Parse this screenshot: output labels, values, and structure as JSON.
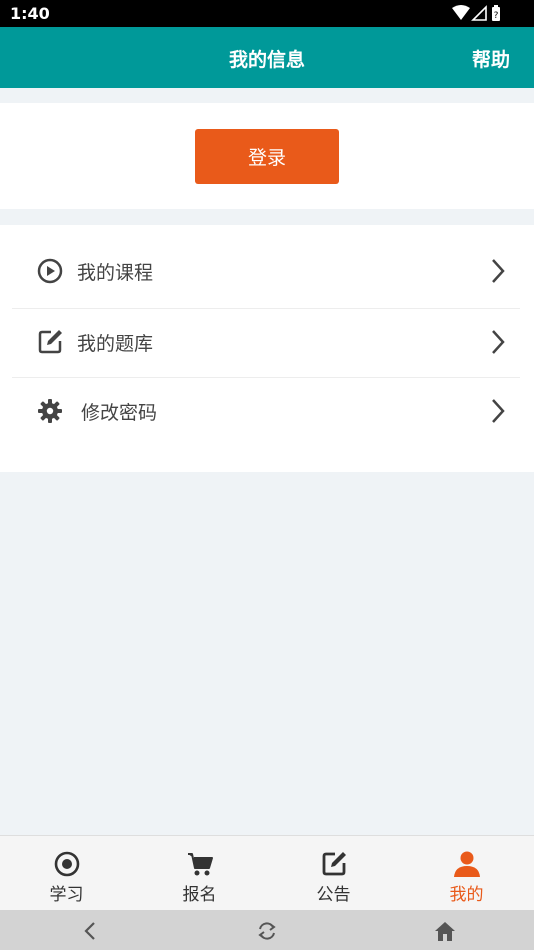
{
  "status_bar": {
    "time": "1:40",
    "icons": [
      "wifi-icon",
      "signal-icon",
      "battery-icon"
    ]
  },
  "header": {
    "title": "我的信息",
    "help_label": "帮助",
    "background_color": "#009999"
  },
  "login": {
    "button_label": "登录",
    "button_color": "#e95a1a"
  },
  "menu": {
    "items": [
      {
        "label": "我的课程",
        "icon": "play-circle-icon"
      },
      {
        "label": "我的题库",
        "icon": "edit-square-icon"
      },
      {
        "label": "修改密码",
        "icon": "gear-icon"
      }
    ]
  },
  "bottom_nav": {
    "items": [
      {
        "label": "学习",
        "icon": "target-circle-icon",
        "active": false
      },
      {
        "label": "报名",
        "icon": "cart-icon",
        "active": false
      },
      {
        "label": "公告",
        "icon": "edit-square-icon",
        "active": false
      },
      {
        "label": "我的",
        "icon": "user-icon",
        "active": true
      }
    ],
    "active_color": "#e95a1a"
  },
  "system_nav": {
    "buttons": [
      "back-icon",
      "rotate-icon",
      "home-icon"
    ]
  }
}
